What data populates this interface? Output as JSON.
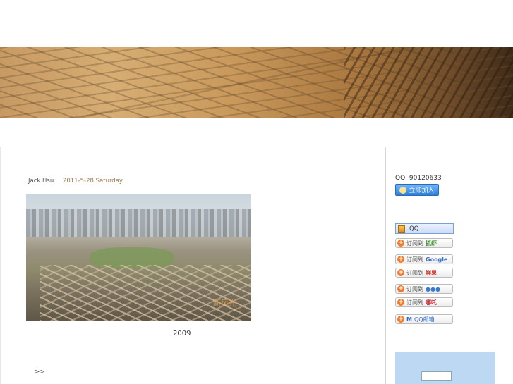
{
  "post": {
    "author": "Jack Hsu",
    "date": "2011-5-28 Saturday",
    "photo_stamp": "新风光",
    "caption": "2009",
    "more": ">>"
  },
  "sidebar": {
    "qq_label": "QQ",
    "qq_number": "90120633",
    "join_button": "立即加入",
    "qq_bar_label": "QQ",
    "subscribe_prefix": "订阅到",
    "subscribe_services": [
      {
        "brand": "抓虾",
        "color": "#3a8a2a"
      },
      {
        "brand": "Google",
        "color": "#3b6fd4"
      },
      {
        "brand": "鲜果",
        "color": "#d0302a"
      },
      {
        "brand": "",
        "color": "#3a7ad0"
      },
      {
        "brand": "哪吒",
        "color": "#c0202a"
      }
    ],
    "mail_button": "QQ邮箱",
    "mail_prefix": "M",
    "box_title": "",
    "box_input_label": "",
    "box_input_value": "",
    "box_go": ""
  }
}
